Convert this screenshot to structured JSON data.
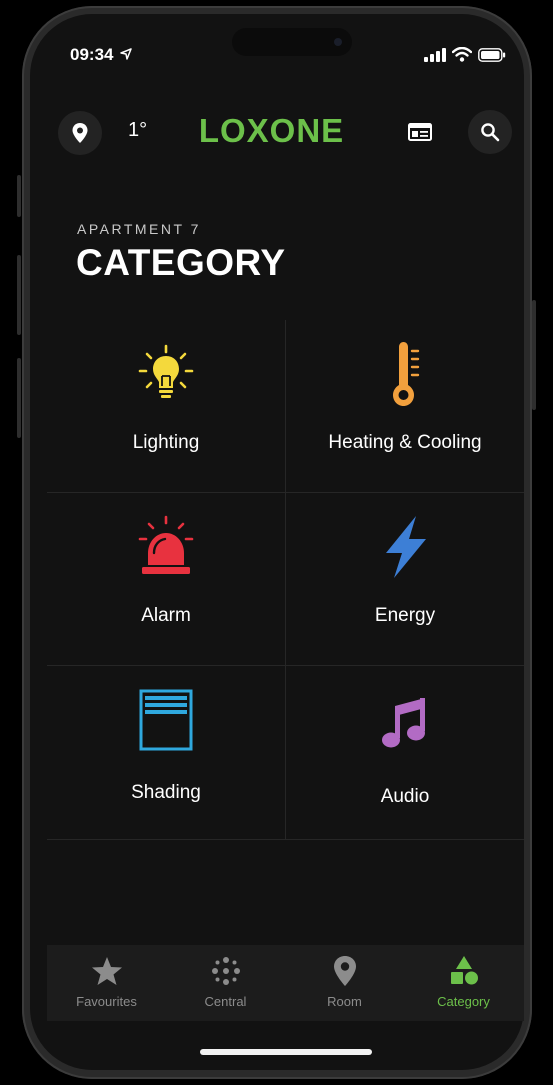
{
  "status_bar": {
    "time": "09:34"
  },
  "header": {
    "temperature": "1°",
    "brand": "LOXONE",
    "location_icon": "location-pin-icon",
    "news_icon": "news-icon",
    "search_icon": "search-icon"
  },
  "page": {
    "subtitle": "APARTMENT 7",
    "title": "CATEGORY"
  },
  "categories": [
    {
      "label": "Lighting",
      "icon": "lightbulb-icon",
      "color": "#f4d93c"
    },
    {
      "label": "Heating & Cooling",
      "icon": "thermometer-icon",
      "color": "#f2a03d"
    },
    {
      "label": "Alarm",
      "icon": "siren-icon",
      "color": "#e8323f"
    },
    {
      "label": "Energy",
      "icon": "lightning-bolt-icon",
      "color": "#3d7fd6"
    },
    {
      "label": "Shading",
      "icon": "blinds-icon",
      "color": "#2fa8de"
    },
    {
      "label": "Audio",
      "icon": "music-note-icon",
      "color": "#b26bc4"
    }
  ],
  "tabs": [
    {
      "label": "Favourites",
      "icon": "star-icon"
    },
    {
      "label": "Central",
      "icon": "dots-icon"
    },
    {
      "label": "Room",
      "icon": "location-pin-icon"
    },
    {
      "label": "Category",
      "icon": "shapes-icon",
      "active": true
    }
  ],
  "colors": {
    "accent": "#6cc04a",
    "background": "#121212"
  }
}
